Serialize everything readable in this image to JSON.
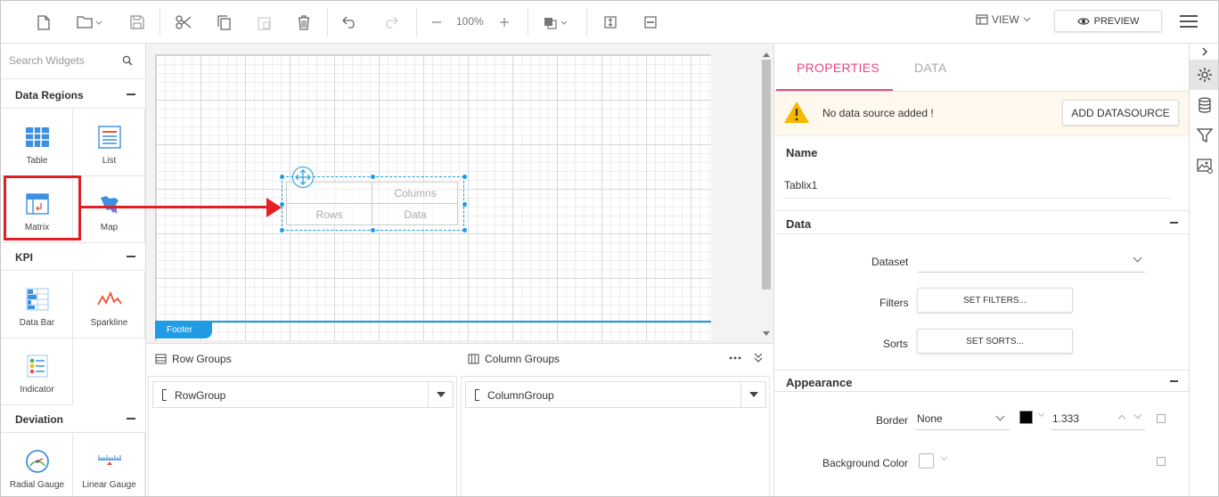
{
  "toolbar": {
    "zoom": "100%",
    "view_label": "VIEW",
    "preview_label": "PREVIEW"
  },
  "widgets": {
    "search_placeholder": "Search Widgets",
    "categories": [
      {
        "label": "Data Regions",
        "items": [
          "Table",
          "List",
          "Matrix",
          "Map"
        ]
      },
      {
        "label": "KPI",
        "items": [
          "Data Bar",
          "Sparkline",
          "Indicator"
        ]
      },
      {
        "label": "Deviation",
        "items": [
          "Radial Gauge",
          "Linear Gauge"
        ]
      }
    ]
  },
  "canvas": {
    "footer_label": "Footer",
    "matrix": {
      "columns": "Columns",
      "rows": "Rows",
      "data": "Data"
    }
  },
  "groups": {
    "row_title": "Row Groups",
    "column_title": "Column Groups",
    "row_group": "RowGroup",
    "column_group": "ColumnGroup"
  },
  "properties": {
    "tabs": [
      "PROPERTIES",
      "DATA"
    ],
    "warning": "No data source added !",
    "add_datasource": "ADD DATASOURCE",
    "name_label": "Name",
    "name_value": "Tablix1",
    "data_section": "Data",
    "dataset_label": "Dataset",
    "filters_label": "Filters",
    "set_filters": "SET FILTERS...",
    "sorts_label": "Sorts",
    "set_sorts": "SET SORTS...",
    "appearance_section": "Appearance",
    "border_label": "Border",
    "border_style": "None",
    "border_width": "1.333",
    "border_color": "#000000",
    "background_label": "Background Color"
  },
  "colors": {
    "accent": "#e8487a",
    "selection": "#1f9ce3",
    "annotation": "#e41e26",
    "warning": "#f5b800"
  }
}
